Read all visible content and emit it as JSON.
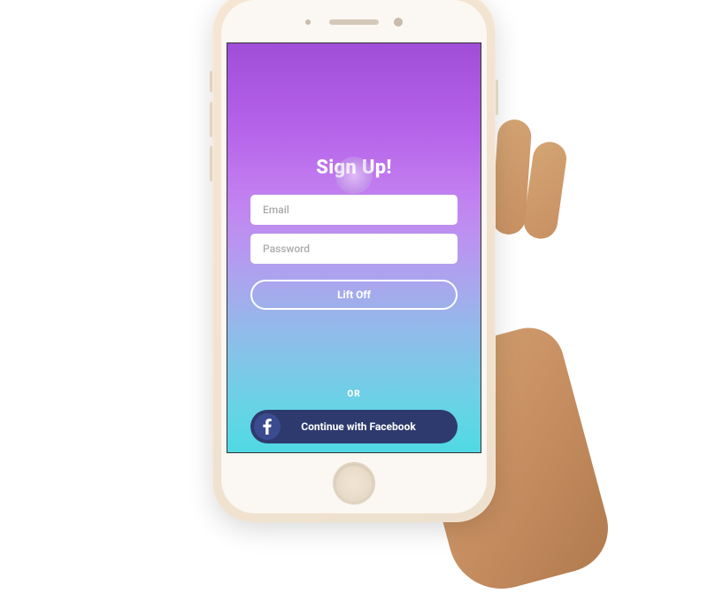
{
  "signup": {
    "title": "Sign Up!",
    "email_placeholder": "Email",
    "password_placeholder": "Password",
    "submit_label": "Lift Off",
    "divider": "OR",
    "facebook_label": "Continue with Facebook"
  },
  "colors": {
    "gradient_top": "#a04dd8",
    "gradient_bottom": "#50d9e3",
    "facebook_bg": "#2e3a6d",
    "input_bg": "#ffffff"
  }
}
